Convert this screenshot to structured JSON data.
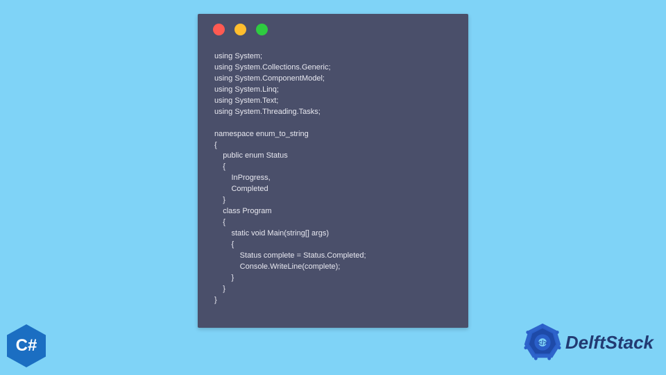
{
  "window": {
    "dots": [
      "red",
      "yellow",
      "green"
    ]
  },
  "code": "using System;\nusing System.Collections.Generic;\nusing System.ComponentModel;\nusing System.Linq;\nusing System.Text;\nusing System.Threading.Tasks;\n\nnamespace enum_to_string\n{\n    public enum Status\n    {\n        InProgress,\n        Completed\n    }\n    class Program\n    {\n        static void Main(string[] args)\n        {\n            Status complete = Status.Completed;\n            Console.WriteLine(complete);\n        }\n    }\n}",
  "badges": {
    "csharp": "C#",
    "brand": "DelftStack"
  },
  "colors": {
    "background": "#7fd3f7",
    "window": "#4a4f6a",
    "csharp_hex": "#1b6ec2",
    "brand_text": "#223a72",
    "brand_accent": "#2a5fc9"
  }
}
